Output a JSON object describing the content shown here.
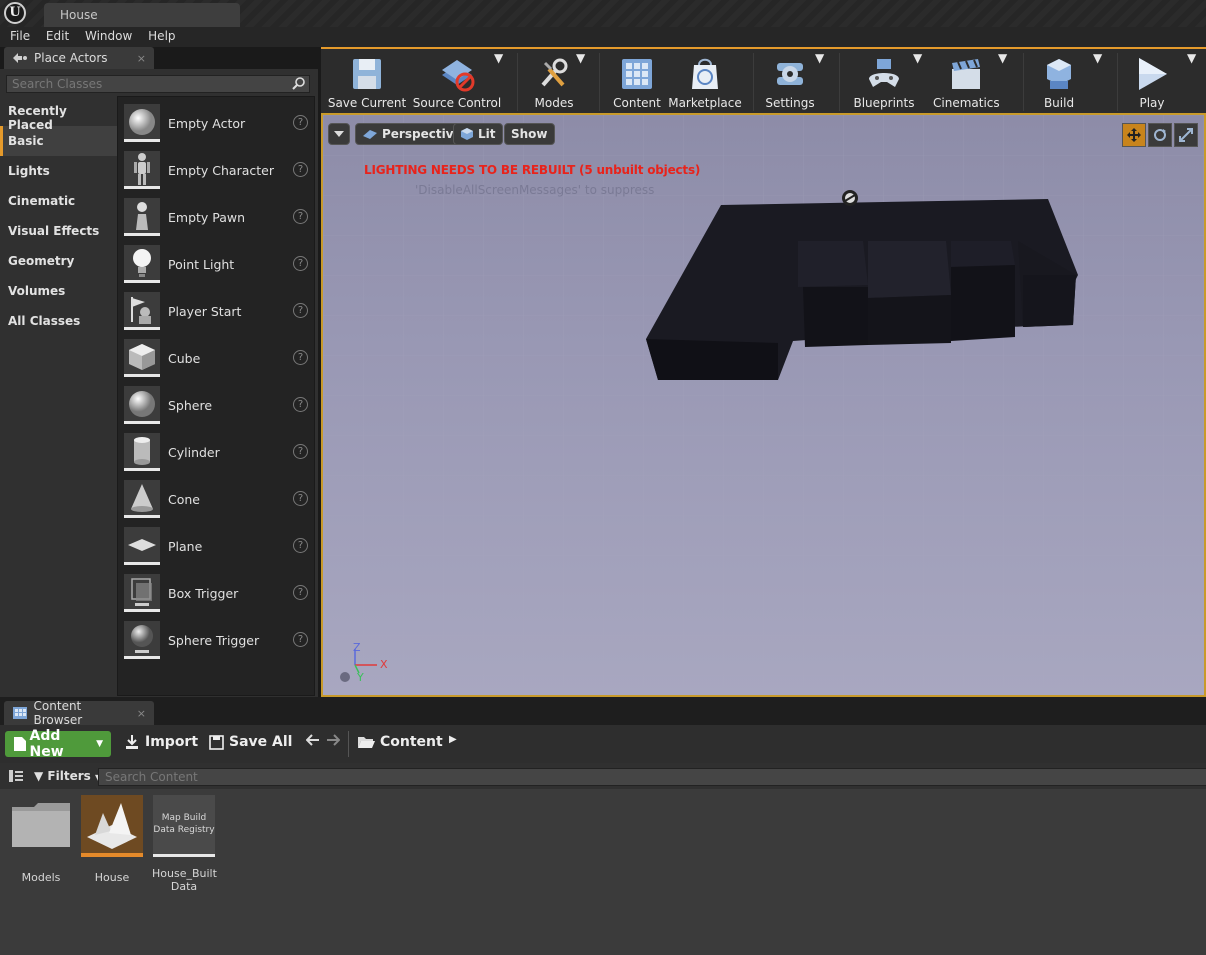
{
  "window": {
    "logo": "U",
    "tab_title": "House"
  },
  "menu": [
    "File",
    "Edit",
    "Window",
    "Help"
  ],
  "place_actors": {
    "tab_label": "Place Actors",
    "close": "×",
    "search_placeholder": "Search Classes",
    "categories": [
      "Recently Placed",
      "Basic",
      "Lights",
      "Cinematic",
      "Visual Effects",
      "Geometry",
      "Volumes",
      "All Classes"
    ],
    "active_category": "Basic",
    "items": [
      "Empty Actor",
      "Empty Character",
      "Empty Pawn",
      "Point Light",
      "Player Start",
      "Cube",
      "Sphere",
      "Cylinder",
      "Cone",
      "Plane",
      "Box Trigger",
      "Sphere Trigger"
    ],
    "help_glyph": "?"
  },
  "toolbar": {
    "buttons": [
      "Save Current",
      "Source Control",
      "Modes",
      "Content",
      "Marketplace",
      "Settings",
      "Blueprints",
      "Cinematics",
      "Build",
      "Play"
    ],
    "accent_color": "#e59a2b"
  },
  "viewport": {
    "perspective_label": "Perspective",
    "lit_label": "Lit",
    "show_label": "Show",
    "warning": "LIGHTING NEEDS TO BE REBUILT (5 unbuilt objects)",
    "suppress_hint": "'DisableAllScreenMessages' to suppress",
    "axis_labels": [
      "Z",
      "X",
      "Y"
    ],
    "warning_color": "#e8231b"
  },
  "content_browser": {
    "tab_label": "Content Browser",
    "close": "×",
    "add_new": "Add New",
    "import": "Import",
    "save_all": "Save All",
    "path": "Content",
    "filters": "Filters",
    "search_placeholder": "Search Content",
    "assets": [
      {
        "label": "Models",
        "thumb_text": ""
      },
      {
        "label": "House",
        "thumb_text": ""
      },
      {
        "label": "House_Built Data",
        "thumb_text": "Map Build Data Registry"
      }
    ],
    "add_color": "#4f9a3b"
  }
}
